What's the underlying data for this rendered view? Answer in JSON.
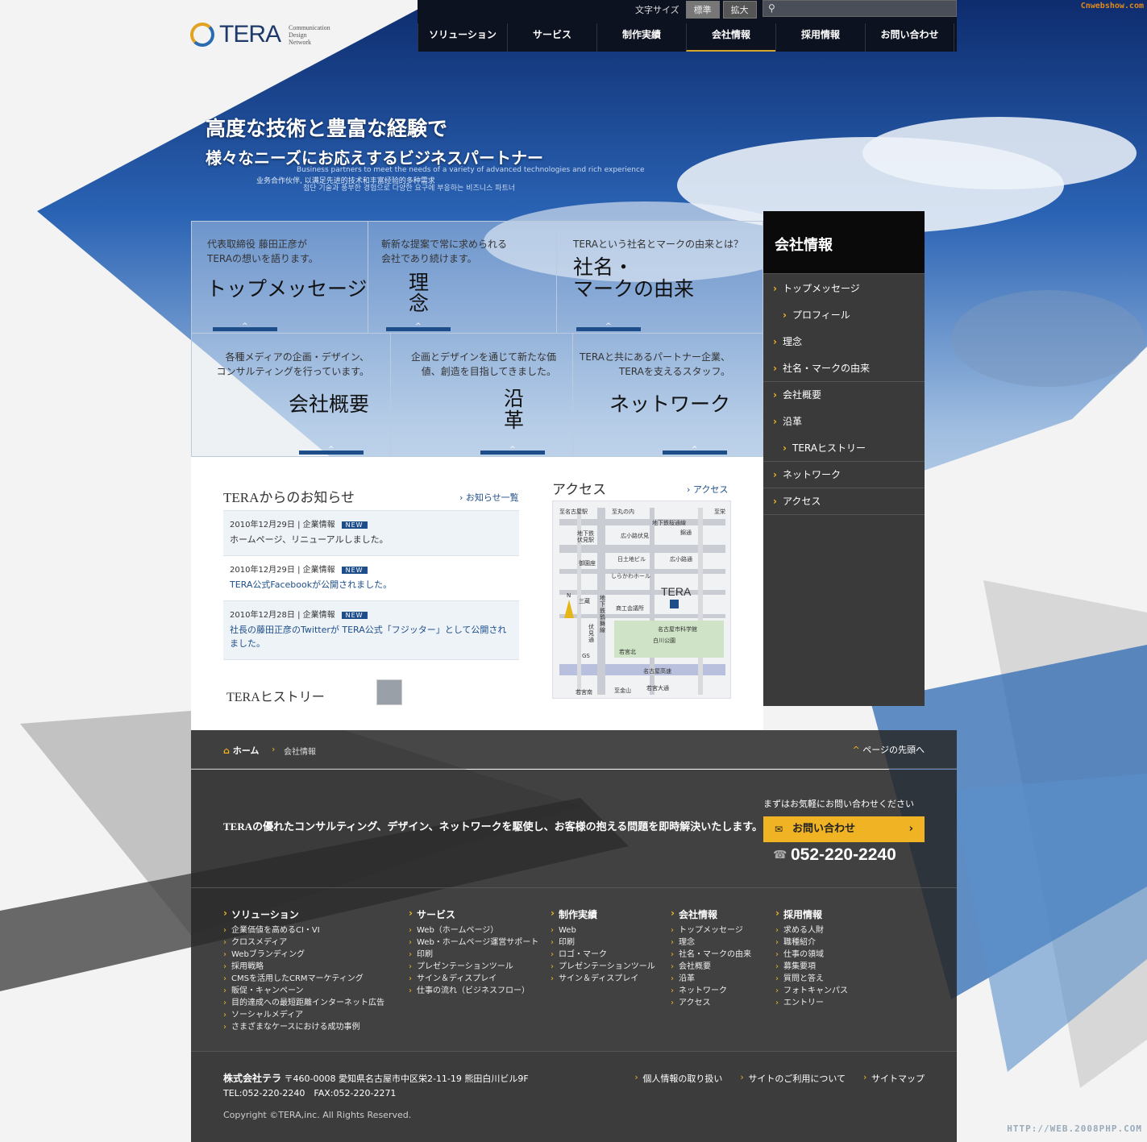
{
  "watermarks": {
    "top": "Cnwebshow.com",
    "bottom": "HTTP://WEB.2008PHP.COM"
  },
  "header": {
    "logo_text": "TERA",
    "logo_sub": [
      "Communication",
      "Design",
      "Network"
    ],
    "font_size_label": "文字サイズ",
    "font_size_options": [
      "標準",
      "拡大"
    ],
    "search_placeholder": "",
    "nav": [
      "ソリューション",
      "サービス",
      "制作実績",
      "会社情報",
      "採用情報",
      "お問い合わせ"
    ],
    "active_nav": "会社情報"
  },
  "hero": {
    "line1": "高度な技術と豊富な経験で",
    "line2": "様々なニーズにお応えするビジネスパートナー",
    "en": "Business partners to meet the needs of a variety of advanced technologies and rich experience",
    "cn": "业务合作伙伴, 以满足先进的技术和丰富经验的多种需求",
    "kr": "첨단 기술과 풍부한 경험으로 다양한 요구에 부응하는 비즈니스 파트너"
  },
  "tiles": [
    {
      "desc": [
        "代表取締役 藤田正彦が",
        "TERAの想いを語ります。"
      ],
      "title": "トップメッセージ"
    },
    {
      "desc": [
        "斬新な提案で常に求められる",
        "会社であり続けます。"
      ],
      "title": "理\n念"
    },
    {
      "desc": [
        "TERAという社名とマークの由来とは？"
      ],
      "title": "社名・\nマークの由来"
    },
    {
      "desc": [
        "各種メディアの企画・デザイン、",
        "コンサルティングを行っています。"
      ],
      "title": "会社概要"
    },
    {
      "desc": [
        "企画とデザインを通じて新たな価",
        "値、創造を目指してきました。"
      ],
      "title": "沿\n革"
    },
    {
      "desc": [
        "TERAと共にあるパートナー企業、",
        "TERAを支えるスタッフ。"
      ],
      "title": "ネットワーク"
    }
  ],
  "sidebar": {
    "title": "会社情報",
    "items": [
      "トップメッセージ",
      "プロフィール",
      "理念",
      "社名・マークの由来",
      "会社概要",
      "沿革",
      "TERAヒストリー",
      "ネットワーク",
      "アクセス"
    ]
  },
  "news": {
    "title": "TERAからのお知らせ",
    "more": "お知らせ一覧",
    "items": [
      {
        "date": "2010年12月29日",
        "cat": "企業情報",
        "badge": "NEW",
        "text": "ホームページ、リニューアルしました。"
      },
      {
        "date": "2010年12月29日",
        "cat": "企業情報",
        "badge": "NEW",
        "text": "TERA公式Facebookが公開されました。"
      },
      {
        "date": "2010年12月28日",
        "cat": "企業情報",
        "badge": "NEW",
        "text": "社長の藤田正彦のTwitterが TERA公式「フジッター」として公開されました。"
      }
    ]
  },
  "history": {
    "title": "TERAヒストリー"
  },
  "access": {
    "title": "アクセス",
    "more": "アクセス",
    "map_labels": [
      "至名古屋駅",
      "至丸の内",
      "至栄",
      "地下鉄桜通線",
      "地下鉄伏見駅",
      "広小路伏見",
      "錦通",
      "御園座",
      "日土地ビル",
      "広小路通",
      "しらかわホール",
      "TERA",
      "三蔵",
      "商工会議所",
      "名古屋市科学館",
      "白川公園",
      "伏見通",
      "若宮北",
      "GS",
      "名古屋高速",
      "若宮南",
      "至金山",
      "若宮大通",
      "地下鉄鶴舞線",
      "N"
    ]
  },
  "footer": {
    "breadcrumb_home": "ホーム",
    "breadcrumb_current": "会社情報",
    "pagetop": "ページの先頭へ",
    "cta_message": "TERAの優れたコンサルティング、デザイン、ネットワークを駆使し、お客様の抱える問題を即時解決いたします。",
    "cta_lead": "まずはお気軽にお問い合わせください",
    "cta_button": "お問い合わせ",
    "tel": "052-220-2240",
    "columns": [
      {
        "title": "ソリューション",
        "items": [
          "企業価値を高めるCI・VI",
          "クロスメディア",
          "Webブランディング",
          "採用戦略",
          "CMSを活用したCRMマーケティング",
          "販促・キャンペーン",
          "目的達成への最短距離インターネット広告",
          "ソーシャルメディア",
          "さまざまなケースにおける成功事例"
        ]
      },
      {
        "title": "サービス",
        "items": [
          "Web（ホームページ）",
          "Web・ホームページ運営サポート",
          "印刷",
          "プレゼンテーションツール",
          "サイン＆ディスプレイ",
          "仕事の流れ（ビジネスフロー）"
        ]
      },
      {
        "title": "制作実績",
        "items": [
          "Web",
          "印刷",
          "ロゴ・マーク",
          "プレゼンテーションツール",
          "サイン＆ディスプレイ"
        ]
      },
      {
        "title": "会社情報",
        "items": [
          "トップメッセージ",
          "理念",
          "社名・マークの由来",
          "会社概要",
          "沿革",
          "ネットワーク",
          "アクセス"
        ]
      },
      {
        "title": "採用情報",
        "items": [
          "求める人財",
          "職種紹介",
          "仕事の領域",
          "募集要項",
          "質問と答え",
          "フォトキャンパス",
          "エントリー"
        ]
      }
    ],
    "company": "株式会社テラ",
    "address": "〒460-0008 愛知県名古屋市中区栄2-11-19 熊田白川ビル9F",
    "telfax": "TEL:052-220-2240　FAX:052-220-2271",
    "util_links": [
      "個人情報の取り扱い",
      "サイトのご利用について",
      "サイトマップ"
    ],
    "copyright": "Copyright ©TERA,inc. All Rights Reserved."
  }
}
